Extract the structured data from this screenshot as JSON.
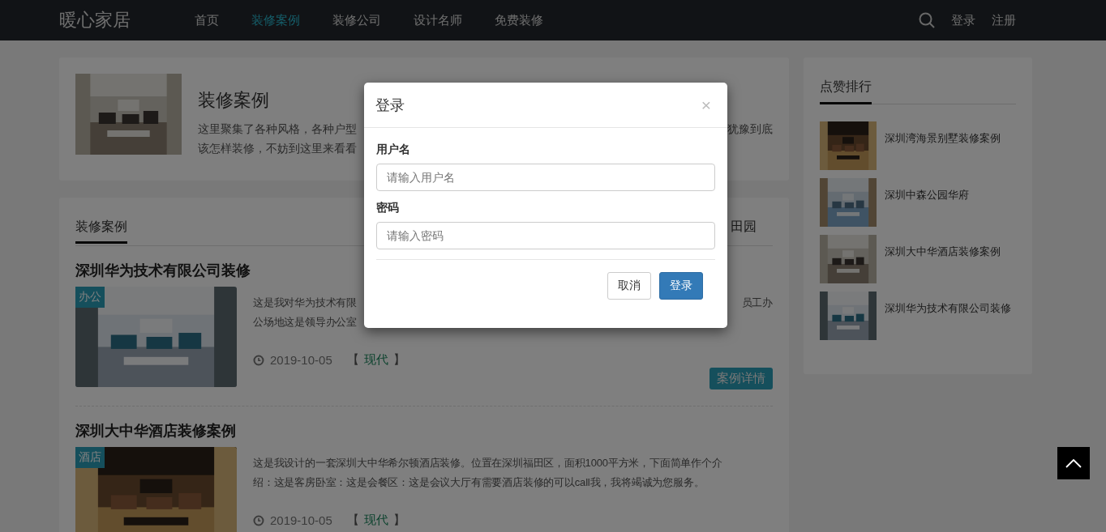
{
  "navbar": {
    "logo": "暖心家居",
    "links": [
      {
        "label": "首页",
        "selected": false
      },
      {
        "label": "装修案例",
        "selected": true
      },
      {
        "label": "装修公司",
        "selected": false
      },
      {
        "label": "设计名师",
        "selected": false
      },
      {
        "label": "免费装修",
        "selected": false
      }
    ],
    "login": "登录",
    "register": "注册"
  },
  "intro": {
    "title": "装修案例",
    "line_1_left": "这里聚集了各种风格，各种户型",
    "line_1_right": "犹豫到底",
    "line_2": "该怎样装修，不妨到这里来看看"
  },
  "cases": {
    "tab": "装修案例",
    "tab_right": "田园",
    "items": [
      {
        "title": "深圳华为技术有限公司装修",
        "tag": "办公",
        "desc_1_left": "这是我对华为技术有限",
        "desc_1_right": "员工办",
        "desc_2": "公场地这是领导办公室",
        "date": "2019-10-05",
        "bracket_open": "【",
        "style": "现代",
        "bracket_close": "】",
        "button": "案例详情"
      },
      {
        "title": "深圳大中华酒店装修案例",
        "tag": "酒店",
        "desc_1_left": "这是我设计的一套深圳大中华希尔顿酒店装修。位置在深圳福田区，面积1000平方米，下面简单作个介",
        "desc_2": "绍：这是客房卧室：这是会餐区：这是会议大厅有需要酒店装修的可以call我，我将竭诚为您服务。",
        "date": "2019-10-05",
        "bracket_open": "【",
        "style": "现代",
        "bracket_close": "】"
      }
    ]
  },
  "ranking": {
    "title": "点赞排行",
    "items": [
      "深圳湾海景别墅装修案例",
      "深圳中森公园华府",
      "深圳大中华酒店装修案例",
      "深圳华为技术有限公司装修"
    ]
  },
  "modal": {
    "title": "登录",
    "close": "×",
    "fields": [
      {
        "label": "用户名",
        "placeholder": "请输入用户名"
      },
      {
        "label": "密码",
        "placeholder": "请输入密码"
      }
    ],
    "cancel": "取消",
    "submit": "登录"
  }
}
